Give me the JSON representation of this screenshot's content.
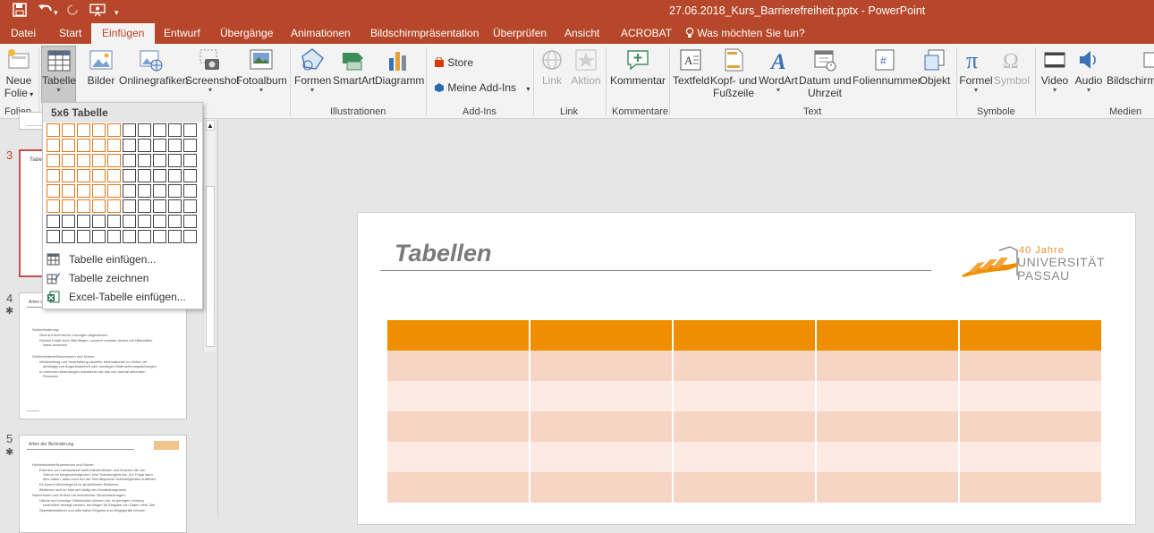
{
  "window": {
    "title": "27.06.2018_Kurs_Barrierefreiheit.pptx - PowerPoint"
  },
  "quick_access": {
    "save": "save-icon",
    "undo": "undo-icon",
    "redo": "redo-icon",
    "present": "present-icon",
    "customize": "▾"
  },
  "tabs": [
    "Datei",
    "Start",
    "Einfügen",
    "Entwurf",
    "Übergänge",
    "Animationen",
    "Bildschirmpräsentation",
    "Überprüfen",
    "Ansicht",
    "ACROBAT"
  ],
  "active_tab": "Einfügen",
  "tell_me": "Was möchten Sie tun?",
  "ribbon": {
    "neue_folie_1": "Neue",
    "neue_folie_2": "Folie",
    "tabelle": "Tabelle",
    "bilder": "Bilder",
    "onlinegrafiken": "Onlinegrafiken",
    "screenshot": "Screenshot",
    "fotoalbum": "Fotoalbum",
    "formen": "Formen",
    "smartart": "SmartArt",
    "diagramm": "Diagramm",
    "store": "Store",
    "meine_addins": "Meine Add-Ins",
    "link": "Link",
    "aktion": "Aktion",
    "kommentar": "Kommentar",
    "textfeld": "Textfeld",
    "kopf_1": "Kopf- und",
    "kopf_2": "Fußzeile",
    "wordart": "WordArt",
    "datum_1": "Datum und",
    "datum_2": "Uhrzeit",
    "foliennummer": "Foliennummer",
    "objekt": "Objekt",
    "formel": "Formel",
    "symbol": "Symbol",
    "video": "Video",
    "audio": "Audio",
    "bildschirm": "Bildschirma"
  },
  "groups": {
    "folien": "Folien",
    "illustrationen": "Illustrationen",
    "addins": "Add-Ins",
    "link": "Link",
    "kommentare": "Kommentare",
    "text": "Text",
    "symbole": "Symbole",
    "medien": "Medien"
  },
  "dropdown": {
    "title": "5x6 Tabelle",
    "grid_cols": 10,
    "grid_rows": 8,
    "selected_cols": 5,
    "selected_rows": 6,
    "items": [
      "Tabelle einfügen...",
      "Tabelle zeichnen",
      "Excel-Tabelle einfügen..."
    ]
  },
  "thumbnails": {
    "slide3_num": "3",
    "slide3_title": "Tabellen",
    "slide4_num": "4",
    "slide4_title": "Arten der Behinderung",
    "slide4_b1": "Sehbehinderung:",
    "slide4_b1a": "Sind auf technische Lösungen angewiesen",
    "slide4_b1b": "Kleines Inhalt nicht überfliegen, sondern müssen diesen mit Hilfsmitteln",
    "slide4_b1c": "linear auslesen",
    "slide4_b2": "Sehbehinderte/Nutzerinnen und Nutzer",
    "slide4_b2a": "Weiterleitung und Verarbeitung visueller Informationen im Gehirn ist",
    "slide4_b2b": "abhängig von Augenkrankheit oder sonstigen Wahrnehmungsstörungen",
    "slide4_b2c": "In mehreren Abstufungen schwächer als das von normal sehenden",
    "slide4_b2d": "Personen",
    "slide5_num": "5",
    "slide5_title": "Arten der Behinderung",
    "slide5_b1": "Hörbehinderte/Nutzerinnen und Nutzer:",
    "slide5_b1a": "Erlernen von Lautsprache stellt teilbetroffenen und Nutzern die von",
    "slide5_b1b": "Geburt an hörgeschädigt sind, eine Schwierigkeit dar. Zur Folge kann",
    "slide5_b1c": "dies haben, dass auch bei der Schriftsprache Schwierigkeiten auftreten",
    "slide5_b1d": "Es kommt überwiegend zu sprachlichen Barrieren",
    "slide5_b1e": "Bedienen sich im Internet häufig der Gebärdensprache",
    "slide5_b2": "Nutzerinnen und Nutzer mit motorischen Einschränkungen:",
    "slide5_b2a": "Hände und sonstige Gliedmaßen können nur im geringen Umfang",
    "slide5_b2b": "kontrolliert bewegt werden, benötigen für Eingabe von Daten mehr Zeit",
    "slide5_b2c": "Spezialtastaturen und alternative Eingabe und Zeigegeräte können"
  },
  "slide": {
    "title": "Tabellen",
    "logo_line1": "40 Jahre",
    "logo_line2": "UNIVERSITÄT",
    "logo_line3": "PASSAU",
    "table_cols": 5,
    "table_rows": 6
  },
  "colors": {
    "accent": "#b7472a",
    "table_header": "#ef8f00",
    "table_band1": "#f6d5c4",
    "table_band2": "#fbebe3",
    "grid_selected": "#e07a20"
  }
}
